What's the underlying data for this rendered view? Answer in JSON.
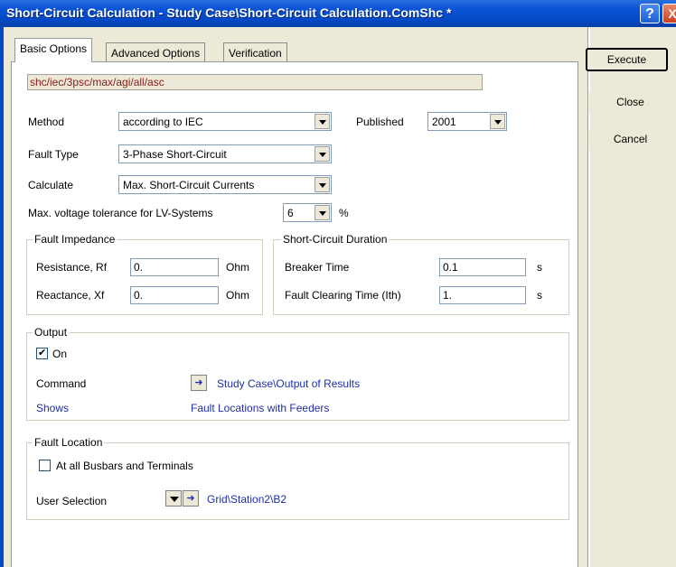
{
  "window": {
    "title": "Short-Circuit Calculation - Study Case\\Short-Circuit Calculation.ComShc *",
    "help_label": "?",
    "close_label": "X"
  },
  "tabs": [
    {
      "label": "Basic Options",
      "active": true
    },
    {
      "label": "Advanced Options",
      "active": false
    },
    {
      "label": "Verification",
      "active": false
    }
  ],
  "command_string": "shc/iec/3psc/max/agi/all/asc",
  "method": {
    "label": "Method",
    "value": "according to IEC"
  },
  "published": {
    "label": "Published",
    "value": "2001"
  },
  "fault_type": {
    "label": "Fault Type",
    "value": "3-Phase Short-Circuit"
  },
  "calculate": {
    "label": "Calculate",
    "value": "Max. Short-Circuit Currents"
  },
  "voltage_tolerance": {
    "label": "Max. voltage tolerance for LV-Systems",
    "value": "6",
    "unit": "%"
  },
  "fault_impedance": {
    "title": "Fault Impedance",
    "resistance": {
      "label": "Resistance, Rf",
      "value": "0.",
      "unit": "Ohm"
    },
    "reactance": {
      "label": "Reactance, Xf",
      "value": "0.",
      "unit": "Ohm"
    }
  },
  "sc_duration": {
    "title": "Short-Circuit Duration",
    "breaker_time": {
      "label": "Breaker Time",
      "value": "0.1",
      "unit": "s"
    },
    "clearing_time": {
      "label": "Fault Clearing Time (Ith)",
      "value": "1.",
      "unit": "s"
    }
  },
  "output": {
    "title": "Output",
    "on_label": "On",
    "on_checked": true,
    "command_label": "Command",
    "command_value": "Study Case\\Output of Results",
    "shows_label": "Shows",
    "shows_value": "Fault Locations with Feeders"
  },
  "fault_location": {
    "title": "Fault Location",
    "all_busbars_label": "At all Busbars and Terminals",
    "all_busbars_checked": false,
    "user_selection_label": "User Selection",
    "user_selection_value": "Grid\\Station2\\B2"
  },
  "buttons": {
    "execute": "Execute",
    "close": "Close",
    "cancel": "Cancel"
  }
}
